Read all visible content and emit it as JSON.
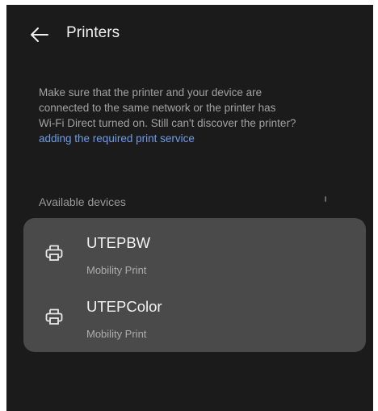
{
  "header": {
    "title": "Printers",
    "back_icon": "arrow-left-icon"
  },
  "info": {
    "lines": [
      "Make sure that the printer and your device are",
      "connected to the same network or the printer has",
      "Wi-Fi Direct turned on. Still can't discover the printer?"
    ],
    "link": "adding the required print service"
  },
  "available": {
    "label": "Available devices",
    "devices": [
      {
        "name": "UTEPBW",
        "service": "Mobility Print",
        "icon": "printer-icon"
      },
      {
        "name": "UTEPColor",
        "service": "Mobility Print",
        "icon": "printer-icon"
      }
    ]
  },
  "colors": {
    "background": "#1b1b1b",
    "card": "#4a4a4a",
    "link": "#6e9bea",
    "text_primary": "#f0f0f0",
    "text_secondary": "#a2a2a2"
  }
}
